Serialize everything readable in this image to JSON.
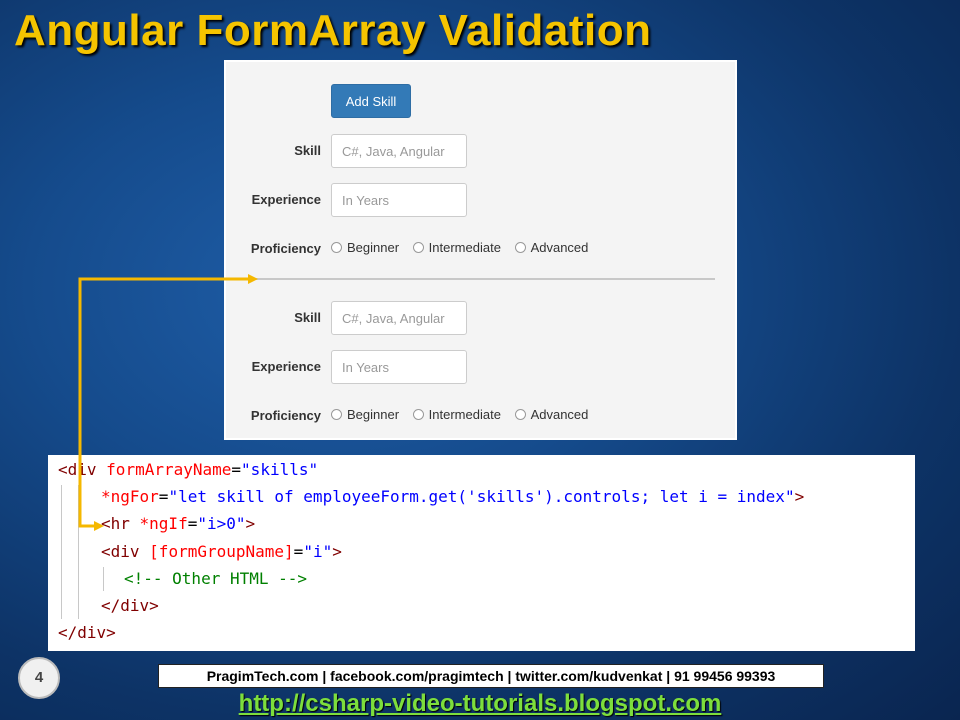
{
  "slide": {
    "title": "Angular FormArray Validation",
    "page_number": "4"
  },
  "form": {
    "add_button_label": "Add Skill",
    "groups": [
      {
        "skill_label": "Skill",
        "skill_placeholder": "C#, Java, Angular",
        "experience_label": "Experience",
        "experience_placeholder": "In Years",
        "proficiency_label": "Proficiency",
        "options": [
          "Beginner",
          "Intermediate",
          "Advanced"
        ]
      },
      {
        "skill_label": "Skill",
        "skill_placeholder": "C#, Java, Angular",
        "experience_label": "Experience",
        "experience_placeholder": "In Years",
        "proficiency_label": "Proficiency",
        "options": [
          "Beginner",
          "Intermediate",
          "Advanced"
        ]
      }
    ]
  },
  "code": {
    "lines": [
      [
        [
          "tag",
          "<div "
        ],
        [
          "attr",
          "formArrayName"
        ],
        [
          "pl",
          "="
        ],
        [
          "str",
          "\"skills\""
        ]
      ],
      [
        [
          "attr",
          "*ngFor"
        ],
        [
          "pl",
          "="
        ],
        [
          "str",
          "\"let skill of employeeForm.get('skills').controls; let i = index\""
        ],
        [
          "tag",
          ">"
        ]
      ],
      [
        [
          "tag",
          "<hr "
        ],
        [
          "attr",
          "*ngIf"
        ],
        [
          "pl",
          "="
        ],
        [
          "str",
          "\"i>0\""
        ],
        [
          "tag",
          ">"
        ]
      ],
      [
        [
          "tag",
          "<div "
        ],
        [
          "attr",
          "[formGroupName]"
        ],
        [
          "pl",
          "="
        ],
        [
          "str",
          "\"i\""
        ],
        [
          "tag",
          ">"
        ]
      ],
      [
        [
          "cm",
          "<!-- Other HTML -->"
        ]
      ],
      [
        [
          "tag",
          "</div>"
        ]
      ],
      [
        [
          "tag",
          "</div>"
        ]
      ]
    ]
  },
  "footer": {
    "contact": "PragimTech.com | facebook.com/pragimtech | twitter.com/kudvenkat | 91 99456 99393",
    "url": "http://csharp-video-tutorials.blogspot.com"
  },
  "colors": {
    "title": "#f5c400",
    "arrow": "#f5b800",
    "button": "#337ab7",
    "url": "#7dde3c"
  }
}
